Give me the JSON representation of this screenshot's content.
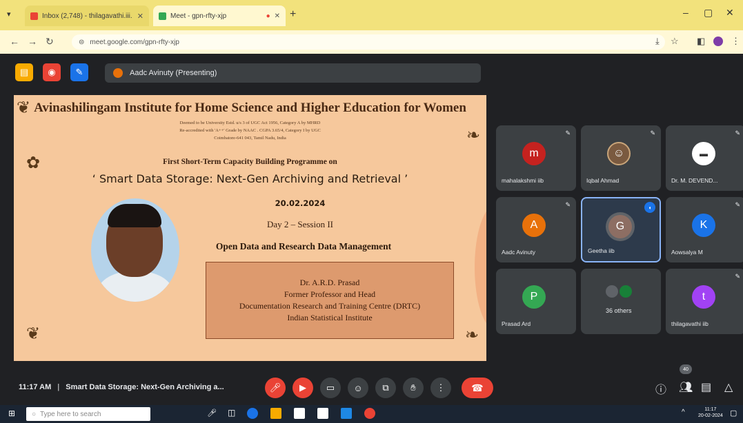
{
  "browser": {
    "tabs": [
      {
        "title": "Inbox (2,748) - thilagavathi.iii.",
        "icon": "gmail-icon",
        "active": false
      },
      {
        "title": "Meet - gpn-rfty-xjp",
        "icon": "meet-icon",
        "active": true
      }
    ],
    "url": "meet.google.com/gpn-rfty-xjp",
    "new_tab": "+",
    "minimize": "–",
    "restore": "▢",
    "close": "✕"
  },
  "meet_header": {
    "presenting_label": "Aadc Avinuty (Presenting)"
  },
  "slide": {
    "title": "Avinashilingam Institute for Home Science and Higher Education for Women",
    "line1": "Deemed to be University Estd. u/s 3 of UGC Act 1956, Category A by MHRD",
    "line2": "Re-accredited with 'A++' Grade by NAAC . CGPA 3.65/4, Category I by UGC",
    "line3": "Coimbatore-641 043, Tamil Nadu, India",
    "programme": "First Short-Term Capacity Building Programme on",
    "main_title": "‘ Smart Data Storage: Next-Gen Archiving and Retrieval ’",
    "date": "20.02.2024",
    "day_session": "Day 2 – Session II",
    "topic": "Open Data and Research Data Management",
    "speaker": {
      "name": "Dr. A.R.D. Prasad",
      "role": "Former Professor and Head",
      "dept": "Documentation Research and Training Centre (DRTC)",
      "institute": "Indian Statistical Institute"
    }
  },
  "participants": [
    {
      "name": "mahalakshmi iib",
      "initial": "m",
      "color": "#c5221f",
      "type": "letter"
    },
    {
      "name": "Iqbal Ahmad",
      "initial": "",
      "color": "#5f6368",
      "type": "photo"
    },
    {
      "name": "Dr. M. DEVEND...",
      "initial": "",
      "color": "#ffffff",
      "type": "logo"
    },
    {
      "name": "Aadc Avinuty",
      "initial": "A",
      "color": "#e8710a",
      "type": "letter"
    },
    {
      "name": "Geetha iib",
      "initial": "G",
      "color": "#8d6e63",
      "type": "letter",
      "speaking": true
    },
    {
      "name": "Aowsalya M",
      "initial": "K",
      "color": "#1a73e8",
      "type": "letter"
    },
    {
      "name": "Prasad Ard",
      "initial": "P",
      "color": "#34a853",
      "type": "letter"
    },
    {
      "name": "36 others",
      "initial": "",
      "color": "#5f6368",
      "type": "others"
    },
    {
      "name": "thilagavathi iib",
      "initial": "t",
      "color": "#a142f4",
      "type": "letter"
    }
  ],
  "meeting": {
    "time": "11:17 AM",
    "separator": "|",
    "title": "Smart Data Storage: Next-Gen Archiving a...",
    "participant_count": "40"
  },
  "taskbar": {
    "search_placeholder": "Type here to search",
    "clock_time": "11:17",
    "clock_date": "20-02-2024"
  }
}
